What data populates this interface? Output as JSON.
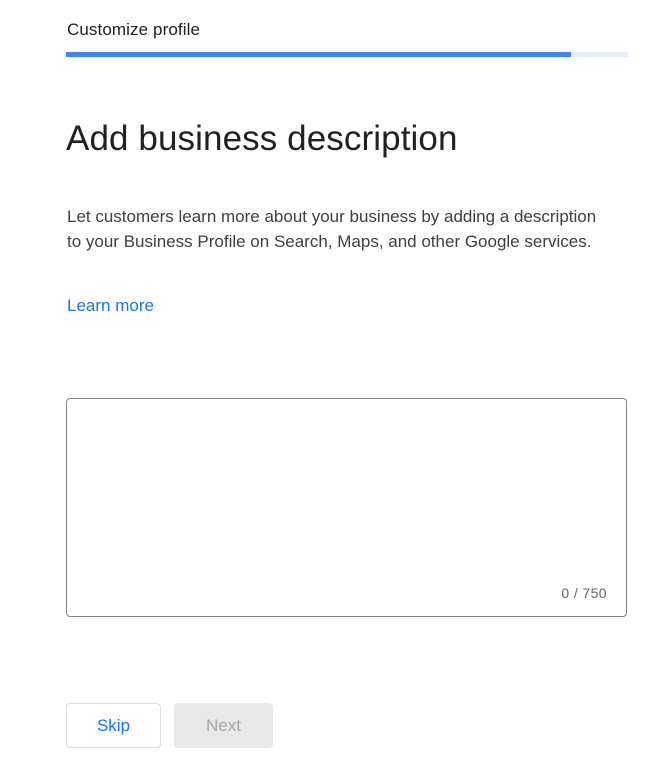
{
  "header": {
    "step_title": "Customize profile",
    "progress_fraction": 0.898
  },
  "main": {
    "heading": "Add business description",
    "description": "Let customers learn more about your business by adding a description to your Business Profile on Search, Maps, and other Google services.",
    "learn_more_label": "Learn more",
    "description_field": {
      "value": "",
      "placeholder": "",
      "counter": "0 / 750"
    }
  },
  "footer": {
    "skip_label": "Skip",
    "next_label": "Next"
  },
  "colors": {
    "accent": "#1a73e8",
    "progress_fill": "#4285f4",
    "progress_track": "#e8f0fe",
    "disabled_bg": "#e8e8e8",
    "disabled_text": "#a6a6a6"
  }
}
